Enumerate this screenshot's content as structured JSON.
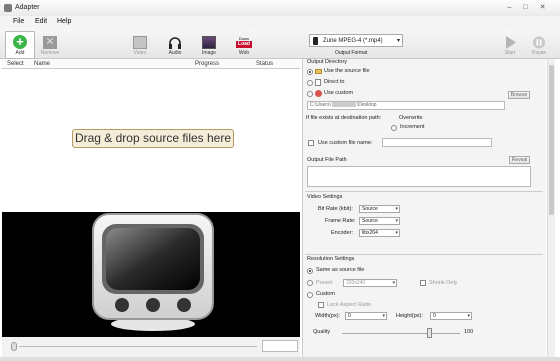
{
  "window": {
    "title": "Adapter",
    "controls": [
      "–",
      "□",
      "✕"
    ]
  },
  "menu": [
    "File",
    "Edit",
    "Help"
  ],
  "toolbar": {
    "add": "Add",
    "remove": "Remove",
    "video": "Video",
    "audio": "Audio",
    "image": "Image",
    "web": "Web",
    "web_icon_top": "Down",
    "web_icon_bottom": "Load",
    "output_format": "Zune MPEG-4 (*.mp4)",
    "output_format_caption": "Output Format",
    "start": "Start",
    "pause": "Pause"
  },
  "list": {
    "columns": [
      "Select",
      "Name",
      "Progress",
      "Status"
    ],
    "drop_hint": "Drag & drop source files here"
  },
  "output_directory": {
    "title": "Output Directory",
    "options": [
      "Use the source file",
      "Direct to",
      "Use custom"
    ],
    "path": "C:\\Users\\",
    "path_suffix": "\\Desktop",
    "browse": "Browse",
    "exists_label": "If file exists at destination path:",
    "exists_options": [
      "Overwrite",
      "Increment"
    ],
    "custom_name_label": "Use custom file name:",
    "output_file_path_label": "Output File Path",
    "reveal": "Reveal"
  },
  "video_settings": {
    "title": "Video Settings",
    "rows": [
      {
        "label": "Bit Rate (kbit):",
        "value": "Source"
      },
      {
        "label": "Frame Rate:",
        "value": "Source"
      },
      {
        "label": "Encoder:",
        "value": "libx264"
      }
    ]
  },
  "resolution_settings": {
    "title": "Resolution Settings",
    "same_as_source": "Same as source file",
    "preset_label": "Preset:",
    "preset_value": "320x240",
    "shrink_only": "Shrink Only",
    "custom": "Custom",
    "lock_aspect": "Lock Aspect Ratio",
    "width_label": "Width(px):",
    "width_value": "0",
    "height_label": "Height(px):",
    "height_value": "0"
  },
  "quality": {
    "label": "Quality",
    "value": "100"
  }
}
